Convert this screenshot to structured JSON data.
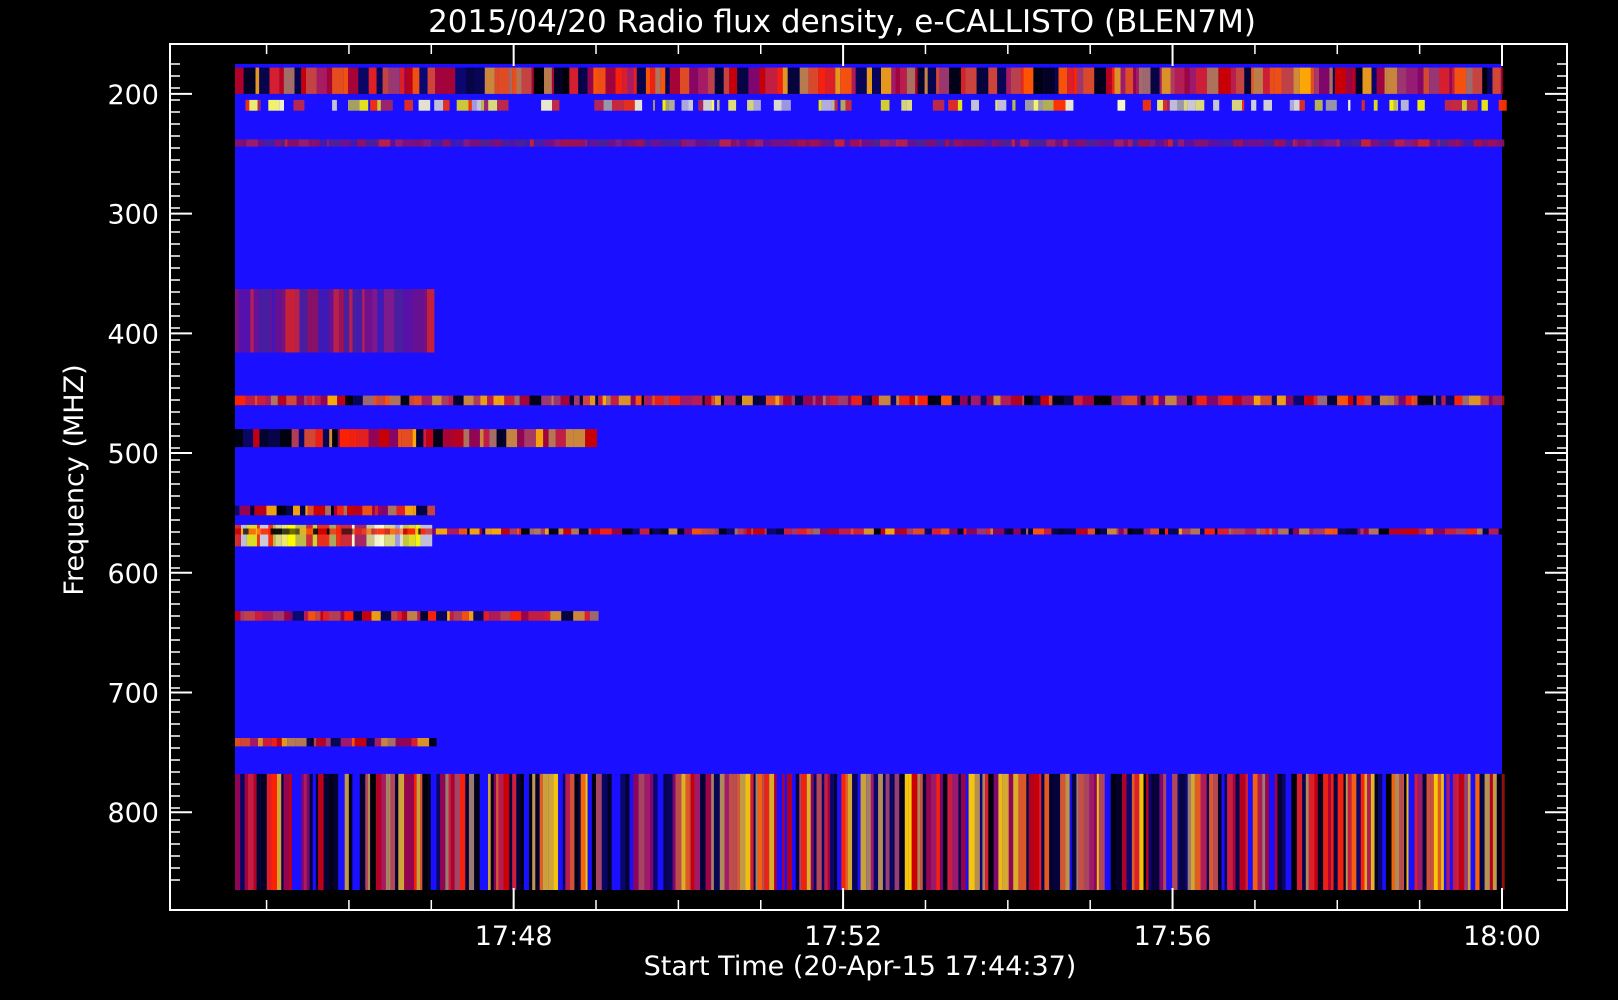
{
  "chart_data": {
    "type": "heatmap",
    "title": "2015/04/20  Radio flux density, e-CALLISTO (BLEN7M)",
    "xlabel": "Start Time (20-Apr-15 17:44:37)",
    "ylabel": "Frequency (MHZ)",
    "x_axis": {
      "unit": "minutes",
      "start": "17:44:37",
      "end": "18:00",
      "tick_labels": [
        "17:48",
        "17:52",
        "17:56",
        "18:00"
      ]
    },
    "y_axis": {
      "inverted": true,
      "range": [
        175,
        865
      ],
      "tick_labels": [
        "200",
        "300",
        "400",
        "500",
        "600",
        "700",
        "800"
      ]
    },
    "colormap": [
      "#000000",
      "#0000ff",
      "#ff0000",
      "#ffff00",
      "#ffffff"
    ],
    "background_color": "#1a10ff",
    "bands": [
      {
        "freq_range": [
          178,
          200
        ],
        "intensity": "high",
        "time_extent": "full"
      },
      {
        "freq_range": [
          205,
          214
        ],
        "intensity": "very-high",
        "time_extent": "intermittent"
      },
      {
        "freq_range": [
          238,
          244
        ],
        "intensity": "medium",
        "time_extent": "full"
      },
      {
        "freq_range": [
          363,
          416
        ],
        "intensity": "medium",
        "time_extent": "17:44-17:47"
      },
      {
        "freq_range": [
          452,
          460
        ],
        "intensity": "high",
        "time_extent": "full"
      },
      {
        "freq_range": [
          480,
          495
        ],
        "intensity": "high",
        "time_extent": "17:44-17:49"
      },
      {
        "freq_range": [
          544,
          552
        ],
        "intensity": "high",
        "time_extent": "17:44-17:47"
      },
      {
        "freq_range": [
          560,
          578
        ],
        "intensity": "very-high",
        "time_extent": "17:44-17:47"
      },
      {
        "freq_range": [
          563,
          568
        ],
        "intensity": "high",
        "time_extent": "full"
      },
      {
        "freq_range": [
          632,
          640
        ],
        "intensity": "high",
        "time_extent": "17:44-17:49"
      },
      {
        "freq_range": [
          738,
          745
        ],
        "intensity": "high",
        "time_extent": "17:44-17:47"
      },
      {
        "freq_range": [
          768,
          865
        ],
        "intensity": "variable-high",
        "time_extent": "full"
      }
    ]
  }
}
